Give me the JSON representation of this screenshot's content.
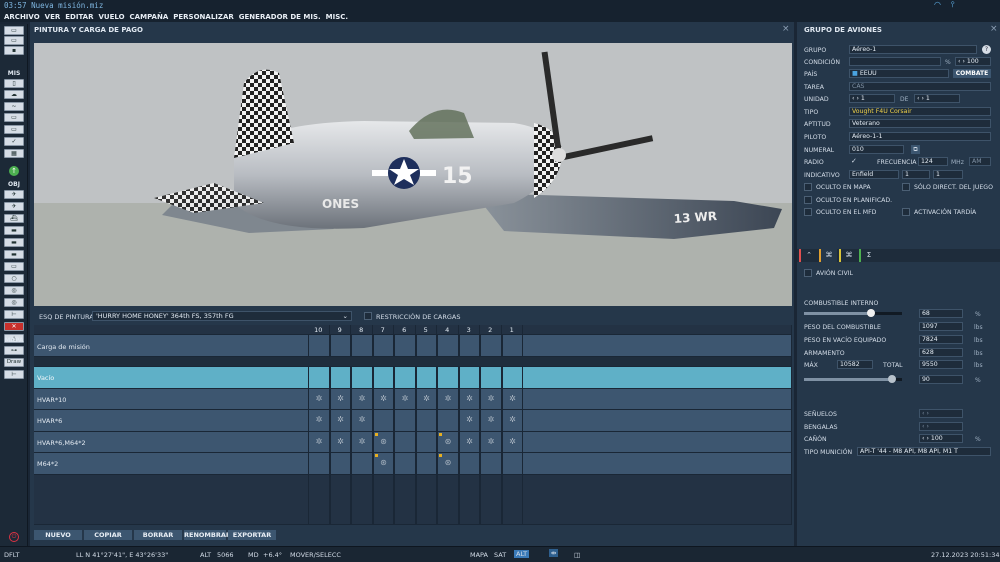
{
  "app": {
    "title": "03:57 Nueva misión.miz"
  },
  "menu": [
    "ARCHIVO",
    "VER",
    "EDITAR",
    "VUELO",
    "CAMPAÑA",
    "PERSONALIZAR",
    "GENERADOR DE MIS.",
    "MISC."
  ],
  "toolbar": {
    "mis_label": "MIS",
    "obj_label": "OBJ",
    "map_label": "MAPA",
    "draw_label": "Draw"
  },
  "left_panel": {
    "title": "PINTURA Y CARGA DE PAGO",
    "plane_number": "15",
    "plane_text": "13 WR",
    "plane_text2": "ONES",
    "paint_label": "ESQ DE PINTURA",
    "paint_value": "'HURRY HOME HONEY' 364th FS, 357th FG",
    "restriction_label": "RESTRICCIÓN DE CARGAS",
    "pylons": [
      "10",
      "9",
      "8",
      "7",
      "6",
      "5",
      "4",
      "3",
      "2",
      "1"
    ],
    "mission_load_label": "Carga de misión",
    "rows": [
      {
        "name": "Vacío",
        "cells": [
          0,
          0,
          0,
          0,
          0,
          0,
          0,
          0,
          0,
          0
        ]
      },
      {
        "name": "HVAR*10",
        "cells": [
          1,
          1,
          1,
          1,
          1,
          1,
          1,
          1,
          1,
          1
        ]
      },
      {
        "name": "HVAR*6",
        "cells": [
          1,
          1,
          1,
          0,
          0,
          0,
          0,
          1,
          1,
          1
        ]
      },
      {
        "name": "HVAR*6,M64*2",
        "cells": [
          1,
          1,
          1,
          2,
          0,
          0,
          2,
          1,
          1,
          1
        ]
      },
      {
        "name": "M64*2",
        "cells": [
          0,
          0,
          0,
          2,
          0,
          0,
          2,
          0,
          0,
          0
        ]
      }
    ],
    "buttons": [
      "NUEVO",
      "COPIAR",
      "BORRAR",
      "RENOMBRAR",
      "EXPORTAR"
    ]
  },
  "right_panel": {
    "title": "GRUPO DE AVIONES",
    "grupo_label": "GRUPO",
    "grupo_value": "Aéreo-1",
    "condicion_label": "CONDICIÓN",
    "condicion_pct": "%",
    "condicion_value": "100",
    "pais_label": "PAÍS",
    "pais_value": "EEUU",
    "combate_label": "COMBATE",
    "tarea_label": "TAREA",
    "tarea_value": "CAS",
    "unidad_label": "UNIDAD",
    "unidad_value": "1",
    "de_label": "DE",
    "de_value": "1",
    "tipo_label": "TIPO",
    "tipo_value": "Vought F4U Corsair",
    "aptitud_label": "APTITUD",
    "aptitud_value": "Veterano",
    "piloto_label": "PILOTO",
    "piloto_value": "Aéreo-1-1",
    "numeral_label": "NUMERAL",
    "numeral_value": "010",
    "radio_label": "RADIO",
    "frecuencia_label": "FRECUENCIA",
    "frecuencia_value": "124",
    "mhz": "MHz",
    "am": "AM",
    "indicativo_label": "INDICATIVO",
    "indicativo_value": "Enfield",
    "ind_num1": "1",
    "ind_num2": "1",
    "checks": [
      "OCULTO EN MAPA",
      "SÓLO DIRECT. DEL JUEGO",
      "OCULTO EN PLANIFICAD.",
      "OCULTO EN EL MFD",
      "ACTIVACIÓN TARDÍA"
    ],
    "avion_civil": "AVIÓN CIVIL",
    "fuel_label": "COMBUSTIBLE INTERNO",
    "fuel_pct": "68",
    "pct": "%",
    "peso_comb_label": "PESO DEL COMBUSTIBLE",
    "peso_comb": "1097",
    "peso_vacio_label": "PESO EN VACÍO EQUIPADO",
    "peso_vacio": "7824",
    "armamento_label": "ARMAMENTO",
    "armamento": "628",
    "max_label": "MÁX",
    "max_value": "10582",
    "total_label": "TOTAL",
    "total_value": "9550",
    "slider2_pct": "90",
    "lbs": "lbs",
    "senuelos_label": "SEÑUELOS",
    "bengalas_label": "BENGALAS",
    "canon_label": "CAÑÓN",
    "canon_value": "100",
    "tipo_mun_label": "TIPO MUNICIÓN",
    "tipo_mun_value": "API-T '44 - M8 API, M8 API, M1 T"
  },
  "status": {
    "mode": "DFLT",
    "coords": "LL   N 41°27'41\", E 43°26'33\"",
    "alt_label": "ALT",
    "alt": "5066",
    "md_label": "MD",
    "md": "+6.4°",
    "action": "MOVER/SELECC",
    "map_btn": "MAPA",
    "sat_btn": "SAT",
    "alt_btn": "ALT",
    "datetime": "27.12.2023 20:51:34"
  },
  "chart_data": null
}
